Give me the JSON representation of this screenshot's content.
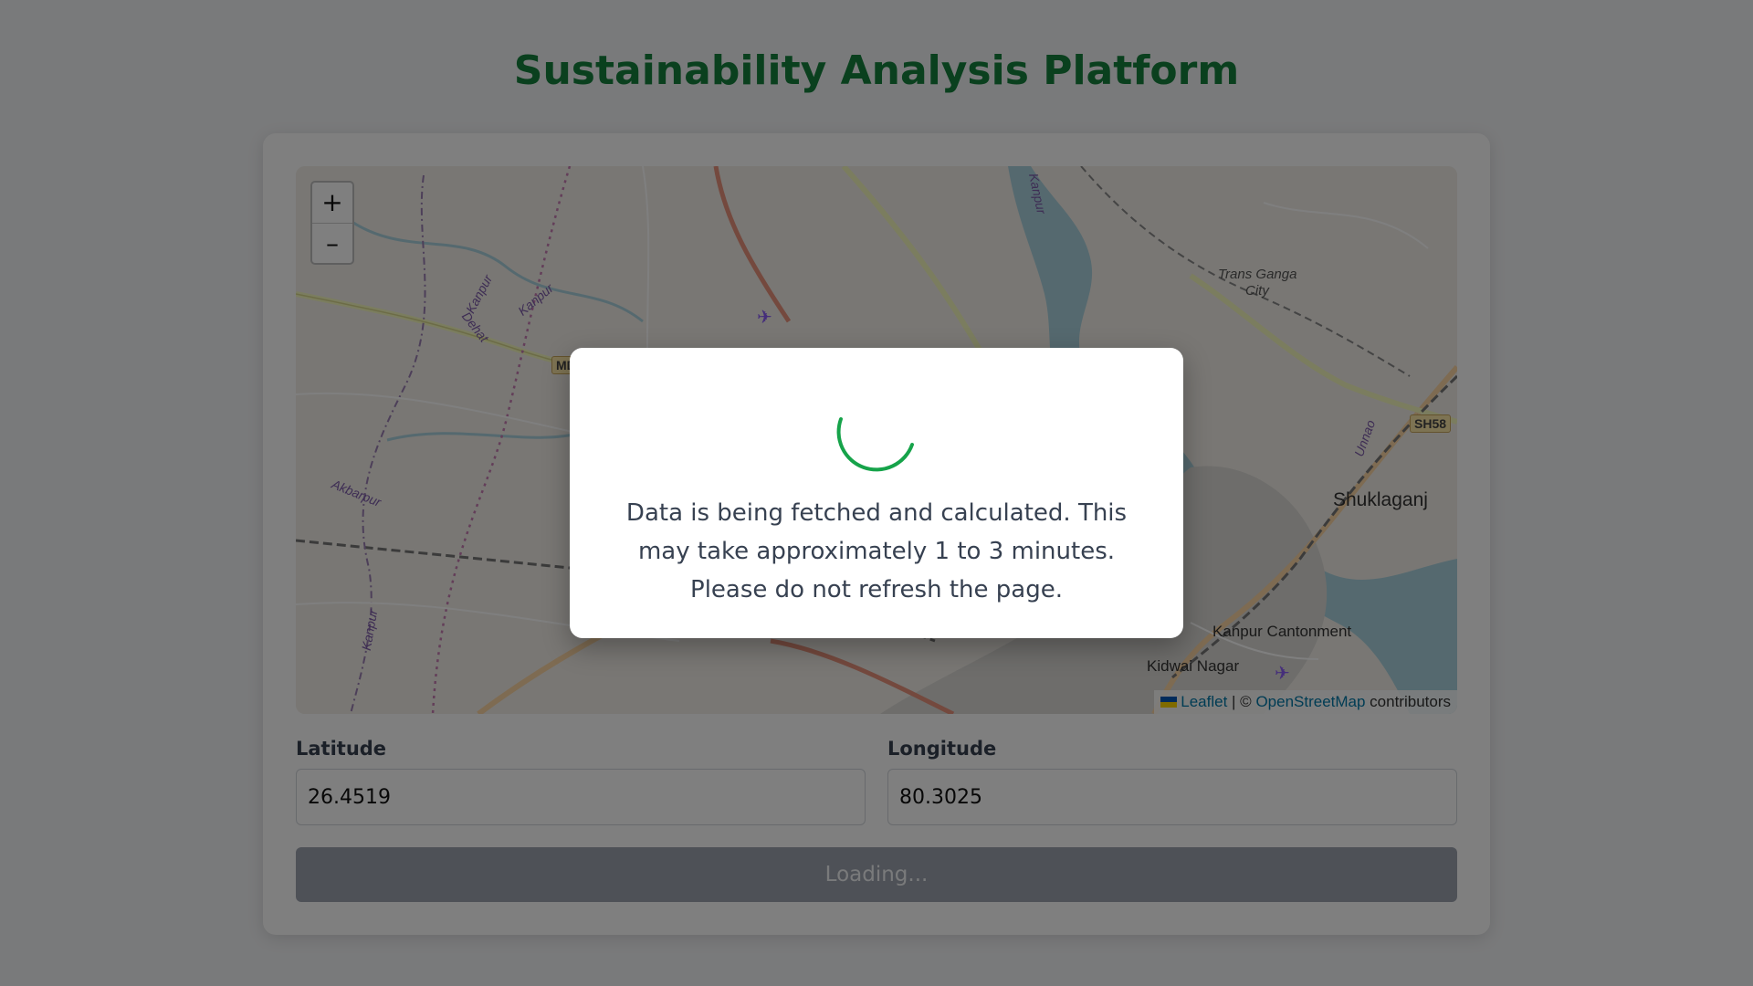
{
  "page": {
    "title": "Sustainability Analysis Platform"
  },
  "map": {
    "zoom_in_label": "+",
    "zoom_out_label": "–",
    "attribution": {
      "leaflet": "Leaflet",
      "separator": " | © ",
      "osm": "OpenStreetMap",
      "suffix": " contributors"
    },
    "places": {
      "trans_ganga": "Trans Ganga",
      "trans_ganga_city": "City",
      "shuklaganj": "Shuklaganj",
      "kanpur_cantonment": "Kanpur Cantonment",
      "kidwai_nagar": "Kidwai Nagar",
      "kanpur_dehat_1": "Kanpur",
      "kanpur_dehat_2": "Dehat",
      "kanpur_a": "Kanpur",
      "kanpur_b": "Kanpur",
      "kanpur_c": "Kanpur",
      "akbarpur": "Akbarpur",
      "unnao": "Unnao",
      "sh58": "SH58",
      "md": "MD"
    }
  },
  "form": {
    "latitude_label": "Latitude",
    "latitude_value": "26.4519",
    "longitude_label": "Longitude",
    "longitude_value": "80.3025",
    "submit_label": "Loading..."
  },
  "modal": {
    "message": "Data is being fetched and calculated. This may take approximately 1 to 3 minutes. Please do not refresh the page."
  },
  "colors": {
    "title_green": "#15803d",
    "spinner_green": "#16a34a",
    "button_disabled": "#9ca3af",
    "river": "#aad3df"
  }
}
